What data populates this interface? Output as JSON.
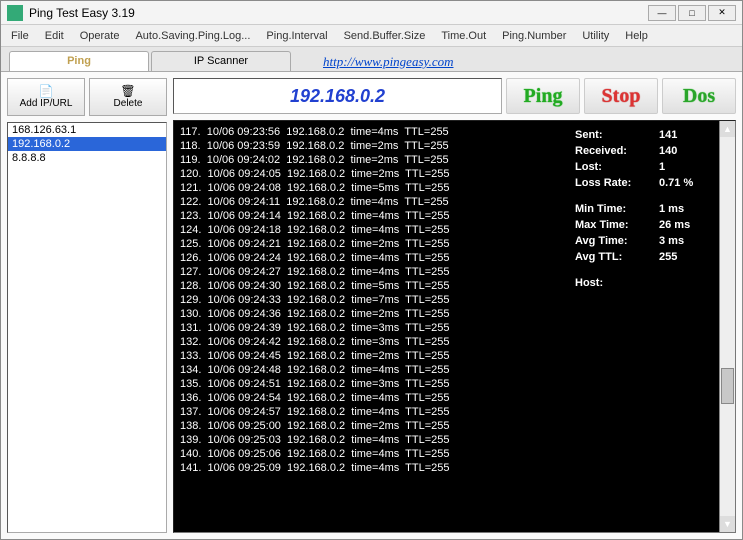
{
  "window": {
    "title": "Ping Test Easy 3.19"
  },
  "winbtns": {
    "min": "—",
    "max": "□",
    "close": "✕"
  },
  "menu": [
    "File",
    "Edit",
    "Operate",
    "Auto.Saving.Ping.Log...",
    "Ping.Interval",
    "Send.Buffer.Size",
    "Time.Out",
    "Ping.Number",
    "Utility",
    "Help"
  ],
  "tabs": {
    "ping": "Ping",
    "scanner": "IP Scanner",
    "link": "http://www.pingeasy.com"
  },
  "toolbar": {
    "add": "Add IP/URL",
    "del": "Delete"
  },
  "ip_list": {
    "items": [
      "168.126.63.1",
      "192.168.0.2",
      "8.8.8.8"
    ],
    "selected_index": 1
  },
  "target_ip": "192.168.0.2",
  "actions": {
    "ping": "Ping",
    "stop": "Stop",
    "dos": "Dos"
  },
  "log": [
    "117.  10/06 09:23:56  192.168.0.2  time=4ms  TTL=255",
    "118.  10/06 09:23:59  192.168.0.2  time=2ms  TTL=255",
    "119.  10/06 09:24:02  192.168.0.2  time=2ms  TTL=255",
    "120.  10/06 09:24:05  192.168.0.2  time=2ms  TTL=255",
    "121.  10/06 09:24:08  192.168.0.2  time=5ms  TTL=255",
    "122.  10/06 09:24:11  192.168.0.2  time=4ms  TTL=255",
    "123.  10/06 09:24:14  192.168.0.2  time=4ms  TTL=255",
    "124.  10/06 09:24:18  192.168.0.2  time=4ms  TTL=255",
    "125.  10/06 09:24:21  192.168.0.2  time=2ms  TTL=255",
    "126.  10/06 09:24:24  192.168.0.2  time=4ms  TTL=255",
    "127.  10/06 09:24:27  192.168.0.2  time=4ms  TTL=255",
    "128.  10/06 09:24:30  192.168.0.2  time=5ms  TTL=255",
    "129.  10/06 09:24:33  192.168.0.2  time=7ms  TTL=255",
    "130.  10/06 09:24:36  192.168.0.2  time=2ms  TTL=255",
    "131.  10/06 09:24:39  192.168.0.2  time=3ms  TTL=255",
    "132.  10/06 09:24:42  192.168.0.2  time=3ms  TTL=255",
    "133.  10/06 09:24:45  192.168.0.2  time=2ms  TTL=255",
    "134.  10/06 09:24:48  192.168.0.2  time=4ms  TTL=255",
    "135.  10/06 09:24:51  192.168.0.2  time=3ms  TTL=255",
    "136.  10/06 09:24:54  192.168.0.2  time=4ms  TTL=255",
    "137.  10/06 09:24:57  192.168.0.2  time=4ms  TTL=255",
    "138.  10/06 09:25:00  192.168.0.2  time=2ms  TTL=255",
    "139.  10/06 09:25:03  192.168.0.2  time=4ms  TTL=255",
    "140.  10/06 09:25:06  192.168.0.2  time=4ms  TTL=255",
    "141.  10/06 09:25:09  192.168.0.2  time=4ms  TTL=255"
  ],
  "stats": {
    "sent_k": "Sent:",
    "sent_v": "141",
    "recv_k": "Received:",
    "recv_v": "140",
    "lost_k": "Lost:",
    "lost_v": "1",
    "lossrate_k": "Loss Rate:",
    "lossrate_v": "0.71 %",
    "min_k": "Min Time:",
    "min_v": "1 ms",
    "max_k": "Max Time:",
    "max_v": "26 ms",
    "avg_k": "Avg Time:",
    "avg_v": "3 ms",
    "avgttl_k": "Avg TTL:",
    "avgttl_v": "255",
    "host_k": "Host:",
    "host_v": ""
  }
}
